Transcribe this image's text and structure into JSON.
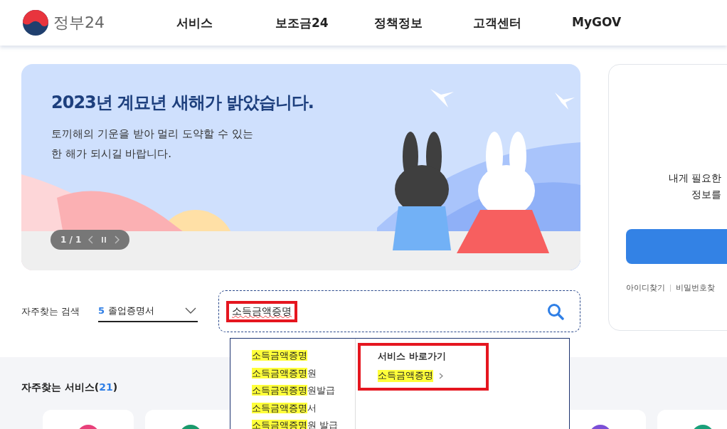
{
  "header": {
    "logo_text": "정부24",
    "nav": [
      {
        "label": "서비스"
      },
      {
        "label": "보조금24"
      },
      {
        "label": "정책정보"
      },
      {
        "label": "고객센터"
      },
      {
        "label": "MyGOV"
      }
    ]
  },
  "banner": {
    "title": "2023년 계묘년 새해가 밝았습니다.",
    "subtitle_lines": [
      "토끼해의 기운을 받아 멀리 도약할 수 있는",
      "한 해가 되시길 바랍니다."
    ],
    "pager": "1 / 1"
  },
  "login_card": {
    "message_lines": [
      "내게 필요한",
      "정보를"
    ],
    "links": [
      "아이디찾기",
      "비밀번호찾"
    ]
  },
  "frequent_search": {
    "label": "자주찾는 검색",
    "rank": "5",
    "keyword": "졸업증명서"
  },
  "search": {
    "value": "소득금액증명",
    "highlighted": true
  },
  "suggestions": {
    "items": [
      {
        "match": "소득금액증명"
      },
      {
        "match": "소득금액증명",
        "rest": "원"
      },
      {
        "match": "소득금액증명",
        "rest": "원발급"
      },
      {
        "match": "소득금액증명",
        "rest": "서"
      },
      {
        "match": "소득금액증명",
        "rest": "원 발급"
      }
    ],
    "shortcut": {
      "title": "서비스 바로가기",
      "link_match": "소득금액증명",
      "highlighted": true
    }
  },
  "services": {
    "title": "자주찾는 서비스(",
    "count": "21",
    "close": ")",
    "cards": [
      {
        "color": "#e8407a"
      },
      {
        "color": "#1a9a6c"
      },
      {
        "color": "#7b4fd6"
      },
      {
        "color": "#1aa07a"
      }
    ]
  }
}
